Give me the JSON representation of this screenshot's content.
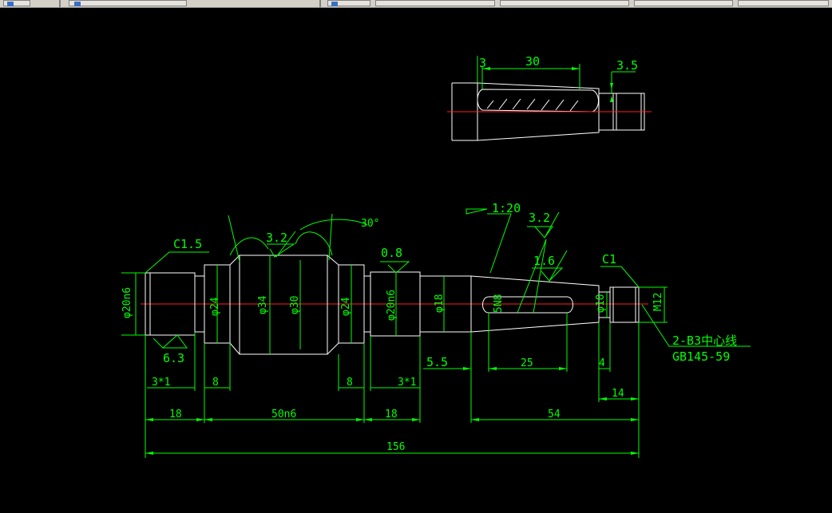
{
  "toolbar": {
    "buttons": [
      "toolbar-button-1",
      "toolbar-button-2",
      "toolbar-button-3",
      "toolbar-button-4",
      "toolbar-button-5",
      "toolbar-button-6",
      "toolbar-button-7",
      "toolbar-button-8"
    ]
  },
  "colors": {
    "background": "#000000",
    "outline": "#ffffff",
    "dimension": "#00ff00",
    "centerline": "#ff2020"
  },
  "detail_view": {
    "dim_3": "3",
    "dim_30": "30",
    "dim_3_5": "3.5"
  },
  "main_view": {
    "chamfer_left": "C1.5",
    "chamfer_right": "C1",
    "taper": "1:20",
    "roughness_3_2_a": "3.2",
    "roughness_3_2_b": "3.2",
    "roughness_0_8": "0.8",
    "roughness_1_6": "1.6",
    "roughness_6_3": "6.3",
    "angle_30": "30°",
    "dia_20n6_left": "φ20n6",
    "dia_24_left": "φ24",
    "dia_34": "φ34",
    "dia_30": "φ30",
    "dia_24_right": "φ24",
    "dia_20n6_right": "φ20n6",
    "dia_18": "φ18",
    "keyway": "5N8",
    "dia_10": "φ10",
    "thread": "M12",
    "center_hole_spec": "2-B3中心线",
    "center_hole_std": "GB145-59",
    "dim_3x1_left": "3*1",
    "dim_8_left": "8",
    "dim_8_right": "8",
    "dim_3x1_right": "3*1",
    "dim_5_5": "5.5",
    "dim_25": "25",
    "dim_4": "4",
    "dim_14": "14",
    "dim_18_left": "18",
    "dim_50n6": "50n6",
    "dim_18_right": "18",
    "dim_54": "54",
    "dim_156": "156"
  }
}
